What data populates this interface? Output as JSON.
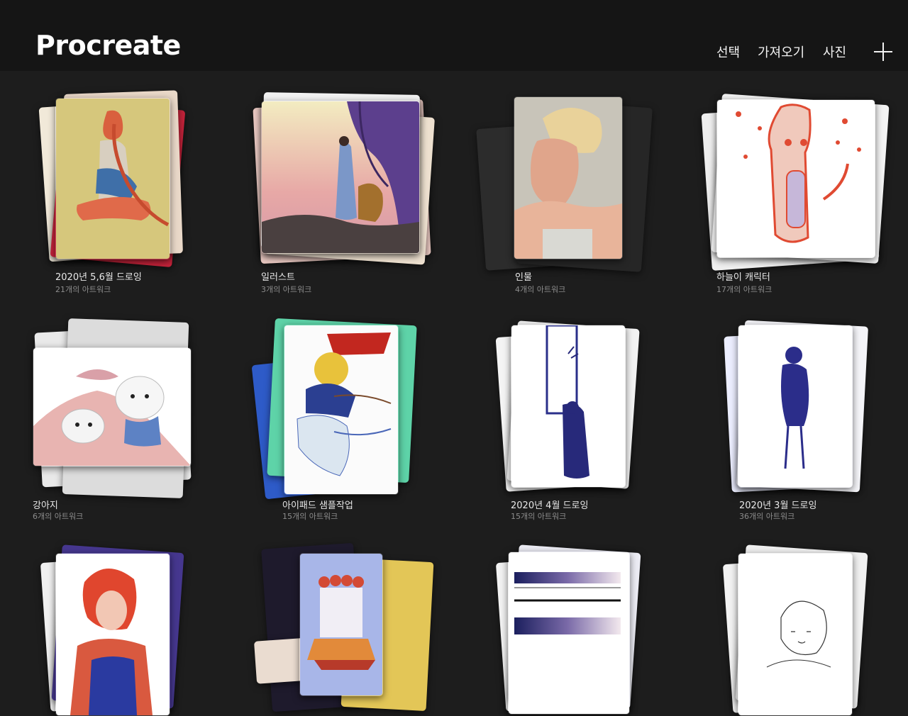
{
  "app": {
    "title": "Procreate"
  },
  "header": {
    "select_label": "선택",
    "import_label": "가져오기",
    "photo_label": "사진"
  },
  "stacks": [
    {
      "name": "2020년 5,6월 드로잉",
      "count": "21개의 아트워크"
    },
    {
      "name": "일러스트",
      "count": "3개의 아트워크"
    },
    {
      "name": "인물",
      "count": "4개의 아트워크"
    },
    {
      "name": "하늘이 캐릭터",
      "count": "17개의 아트워크"
    },
    {
      "name": "강아지",
      "count": "6개의 아트워크"
    },
    {
      "name": "아이패드 샘플작업",
      "count": "15개의 아트워크"
    },
    {
      "name": "2020년 4월 드로잉",
      "count": "15개의 아트워크"
    },
    {
      "name": "2020년 3월 드로잉",
      "count": "36개의 아트워크"
    },
    {
      "name": "",
      "count": ""
    },
    {
      "name": "",
      "count": ""
    },
    {
      "name": "",
      "count": ""
    },
    {
      "name": "",
      "count": ""
    }
  ]
}
